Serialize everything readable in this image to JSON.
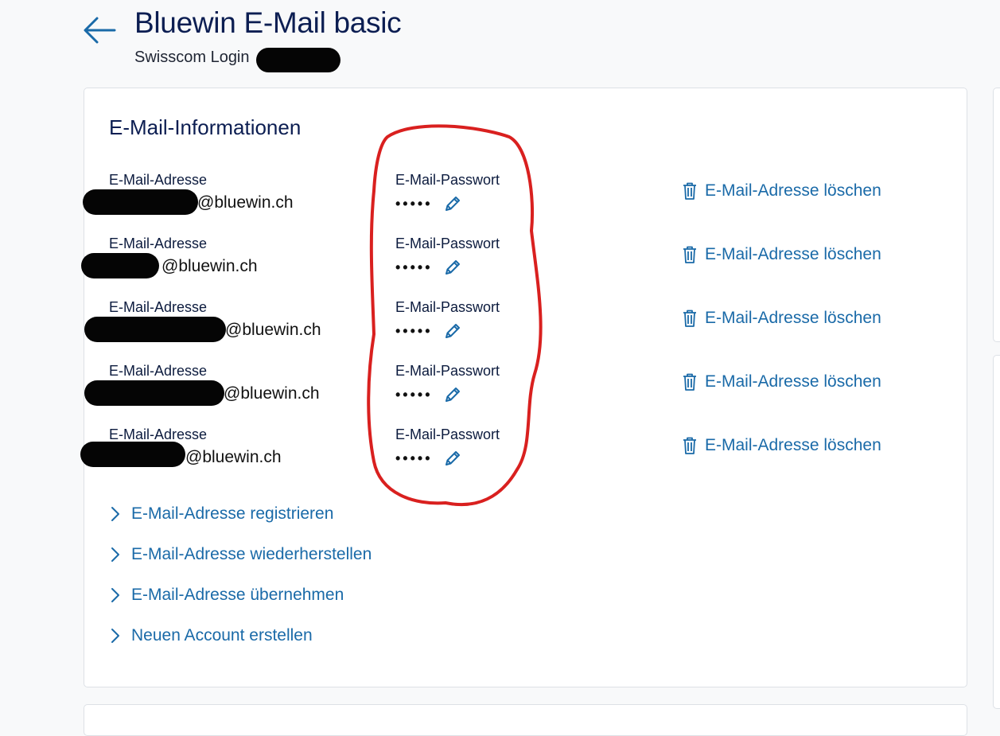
{
  "header": {
    "title": "Bluewin E-Mail basic",
    "subtitle": "Swisscom Login"
  },
  "section": {
    "title": "E-Mail-Informationen"
  },
  "accounts": [
    {
      "address_label": "E-Mail-Adresse",
      "domain": "@bluewin.ch",
      "password_label": "E-Mail-Passwort",
      "password_mask": "•••••",
      "delete_label": "E-Mail-Adresse löschen"
    },
    {
      "address_label": "E-Mail-Adresse",
      "domain": "@bluewin.ch",
      "password_label": "E-Mail-Passwort",
      "password_mask": "•••••",
      "delete_label": "E-Mail-Adresse löschen"
    },
    {
      "address_label": "E-Mail-Adresse",
      "domain": "@bluewin.ch",
      "password_label": "E-Mail-Passwort",
      "password_mask": "•••••",
      "delete_label": "E-Mail-Adresse löschen"
    },
    {
      "address_label": "E-Mail-Adresse",
      "domain": "@bluewin.ch",
      "password_label": "E-Mail-Passwort",
      "password_mask": "•••••",
      "delete_label": "E-Mail-Adresse löschen"
    },
    {
      "address_label": "E-Mail-Adresse",
      "domain": "@bluewin.ch",
      "password_label": "E-Mail-Passwort",
      "password_mask": "•••••",
      "delete_label": "E-Mail-Adresse löschen"
    }
  ],
  "links": [
    {
      "label": "E-Mail-Adresse registrieren"
    },
    {
      "label": "E-Mail-Adresse wiederherstellen"
    },
    {
      "label": "E-Mail-Adresse übernehmen"
    },
    {
      "label": "Neuen Account erstellen"
    }
  ],
  "colors": {
    "link": "#1a6aa8",
    "title": "#0c1e52",
    "annotation": "#d9201f",
    "redaction": "#050505"
  },
  "icons": {
    "back": "arrow-left-icon",
    "edit": "pencil-icon",
    "delete": "trash-icon",
    "link": "chevron-right-icon"
  }
}
